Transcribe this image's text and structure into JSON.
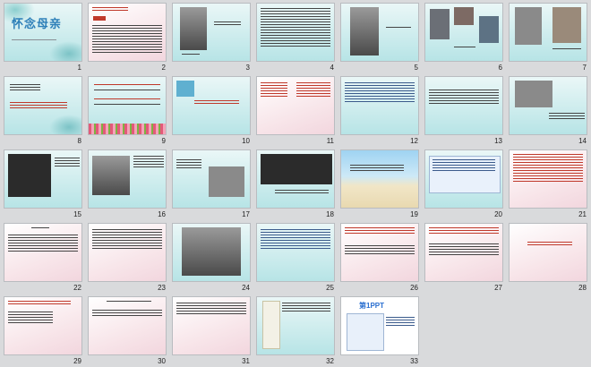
{
  "slides": [
    {
      "num": "1",
      "title": "怀念母亲"
    },
    {
      "num": "2"
    },
    {
      "num": "3"
    },
    {
      "num": "4"
    },
    {
      "num": "5"
    },
    {
      "num": "6"
    },
    {
      "num": "7"
    },
    {
      "num": "8"
    },
    {
      "num": "9"
    },
    {
      "num": "10"
    },
    {
      "num": "11"
    },
    {
      "num": "12"
    },
    {
      "num": "13"
    },
    {
      "num": "14"
    },
    {
      "num": "15"
    },
    {
      "num": "16"
    },
    {
      "num": "17"
    },
    {
      "num": "18"
    },
    {
      "num": "19"
    },
    {
      "num": "20"
    },
    {
      "num": "21"
    },
    {
      "num": "22"
    },
    {
      "num": "23"
    },
    {
      "num": "24"
    },
    {
      "num": "25"
    },
    {
      "num": "26"
    },
    {
      "num": "27"
    },
    {
      "num": "28"
    },
    {
      "num": "29"
    },
    {
      "num": "30"
    },
    {
      "num": "31"
    },
    {
      "num": "32"
    },
    {
      "num": "33",
      "logo": "第1PPT"
    }
  ],
  "colors": {
    "background": "#d9dadc",
    "accent_blue": "#2c7fb8",
    "accent_red": "#c0392b",
    "teal": "#7cc3c6",
    "pink": "#f2d6de"
  }
}
